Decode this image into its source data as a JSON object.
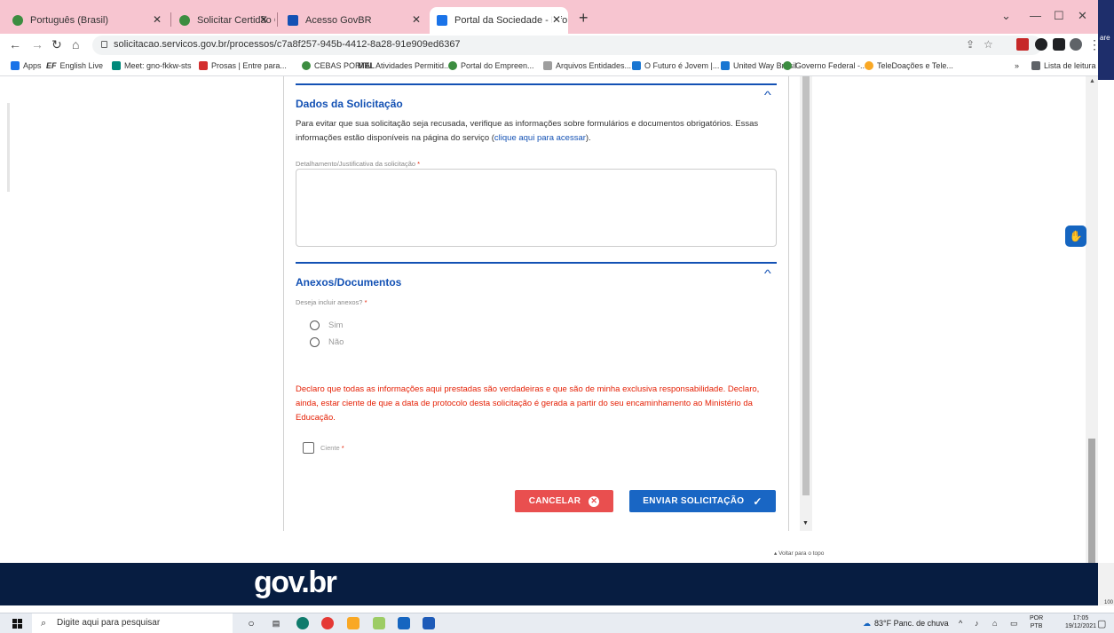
{
  "browser": {
    "tabs": [
      {
        "label": "Português (Brasil)",
        "active": false
      },
      {
        "label": "Solicitar Certidão CEBAS-Educaç",
        "active": false
      },
      {
        "label": "Acesso GovBR",
        "active": false
      },
      {
        "label": "Portal da Sociedade - Informar D",
        "active": true
      }
    ],
    "new_tab": "+",
    "url": "solicitacao.servicos.gov.br/processos/c7a8f257-945b-4412-8a28-91e909ed6367",
    "side_label": "are",
    "bookmarks": [
      "Apps",
      "English Live",
      "Meet: gno-fkkw-sts",
      "Prosas | Entre para...",
      "CEBAS PORTAL",
      "Atividades Permitid...",
      "Portal do Empreen...",
      "Arquivos Entidades...",
      "O Futuro é Jovem |...",
      "United Way Brasil",
      "Governo Federal -...",
      "TeleDoações e Tele..."
    ],
    "bookmark_prefix_ef": "EF",
    "bookmark_prefix_mei": "MEI",
    "reading_list": "Lista de leitura",
    "zoom": "100"
  },
  "form": {
    "section1": {
      "title": "Dados da Solicitação",
      "text_before_link": "Para evitar que sua solicitação seja recusada, verifique as informações sobre formulários e documentos obrigatórios. Essas informações estão disponíveis na página do serviço (",
      "link": "clique aqui para acessar",
      "text_after_link": ").",
      "field_label": "Detalhamento/Justificativa da solicitação",
      "required_mark": "*"
    },
    "section2": {
      "title": "Anexos/Documentos",
      "question": "Deseja incluir anexos?",
      "options": [
        "Sim",
        "Não"
      ]
    },
    "declaration": "Declaro que todas as informações aqui prestadas são verdadeiras e que são de minha exclusiva responsabilidade. Declaro, ainda, estar ciente de que a data de protocolo desta solicitação é gerada a partir do seu encaminhamento ao Ministério da Educação.",
    "ciente_label": "Ciente",
    "cancel_label": "CANCELAR",
    "send_label": "ENVIAR SOLICITAÇÃO"
  },
  "page": {
    "back_to_top": "Voltar para o topo",
    "footer_logo": "gov.br"
  },
  "taskbar": {
    "search_placeholder": "Digite aqui para pesquisar",
    "weather": "83°F  Panc. de chuva",
    "language": "POR",
    "language_sub": "PTB",
    "time": "17:05",
    "date": "19/12/2021"
  },
  "colors": {
    "tabstrip": "#f7c5d0",
    "primary_blue": "#1351b4",
    "danger": "#e52207",
    "cancel_button": "#e94f4f",
    "send_button": "#1966c4",
    "footer": "#071d41"
  }
}
